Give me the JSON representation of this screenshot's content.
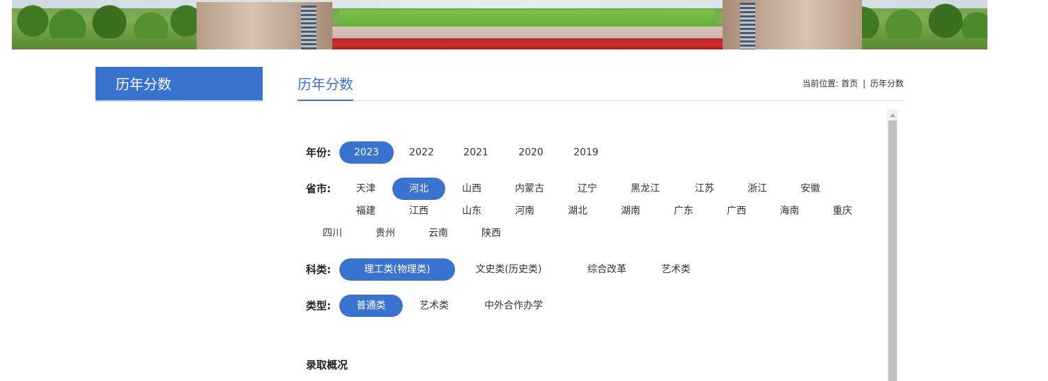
{
  "sidebar": {
    "title": "历年分数"
  },
  "main": {
    "title": "历年分数",
    "breadcrumb": {
      "prefix": "当前位置:",
      "home": "首页",
      "separator": "|",
      "current": "历年分数"
    }
  },
  "filters": {
    "year": {
      "label": "年份:",
      "options": [
        "2023",
        "2022",
        "2021",
        "2020",
        "2019"
      ],
      "selected": "2023"
    },
    "province": {
      "label": "省市:",
      "options": [
        "天津",
        "河北",
        "山西",
        "内蒙古",
        "辽宁",
        "黑龙江",
        "江苏",
        "浙江",
        "安徽",
        "福建",
        "江西",
        "山东",
        "河南",
        "湖北",
        "湖南",
        "广东",
        "广西",
        "海南",
        "重庆",
        "四川",
        "贵州",
        "云南",
        "陕西"
      ],
      "selected": "河北"
    },
    "subject": {
      "label": "科类:",
      "options": [
        "理工类(物理类)",
        "文史类(历史类)",
        "综合改革",
        "艺术类"
      ],
      "selected": "理工类(物理类)"
    },
    "type": {
      "label": "类型:",
      "options": [
        "普通类",
        "艺术类",
        "中外合作办学"
      ],
      "selected": "普通类"
    }
  },
  "section": {
    "title": "录取概况"
  },
  "colors": {
    "accent": "#3a73cf"
  }
}
